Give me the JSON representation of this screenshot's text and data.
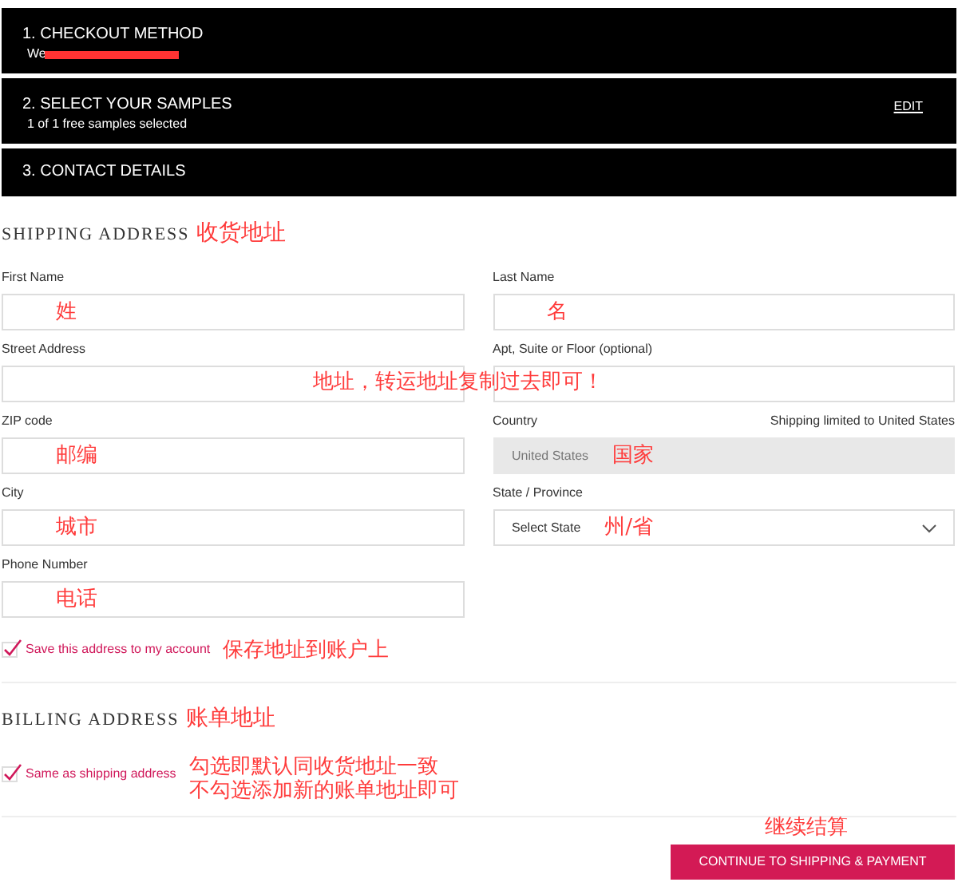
{
  "steps": [
    {
      "title": "1. CHECKOUT METHOD",
      "subtitle": "We",
      "redacted": true
    },
    {
      "title": "2. SELECT YOUR SAMPLES",
      "subtitle": "1 of 1 free samples selected",
      "action": "EDIT"
    },
    {
      "title": "3. CONTACT DETAILS"
    }
  ],
  "shipping": {
    "heading": "SHIPPING ADDRESS",
    "note": "收货地址",
    "fields": [
      {
        "kind": "text",
        "label": "First Name",
        "note": "姓"
      },
      {
        "kind": "text",
        "label": "Last Name",
        "note": "名"
      },
      {
        "kind": "text",
        "label": "Street Address"
      },
      {
        "kind": "text",
        "label": "Apt, Suite or Floor (optional)"
      },
      {
        "kind": "text",
        "label": "ZIP code",
        "note": "邮编"
      },
      {
        "kind": "readonly",
        "label": "Country",
        "hint": "Shipping limited to United States",
        "value": "United States",
        "note": "国家"
      },
      {
        "kind": "text",
        "label": "City",
        "note": "城市"
      },
      {
        "kind": "select",
        "label": "State / Province",
        "value": "Select State",
        "note": "州/省"
      },
      {
        "kind": "text",
        "label": "Phone Number",
        "note": "电话"
      }
    ],
    "address_note": "地址，转运地址复制过去即可！",
    "save": {
      "label": "Save this address to my account",
      "checked": true,
      "note": "保存地址到账户上"
    }
  },
  "billing": {
    "heading": "BILLING ADDRESS",
    "note": "账单地址",
    "same": {
      "label": "Same as shipping address",
      "checked": true,
      "notes": [
        "勾选即默认同收货地址一致",
        "不勾选添加新的账单地址即可"
      ]
    }
  },
  "continue": {
    "label": "CONTINUE TO SHIPPING & PAYMENT",
    "note": "继续结算"
  }
}
